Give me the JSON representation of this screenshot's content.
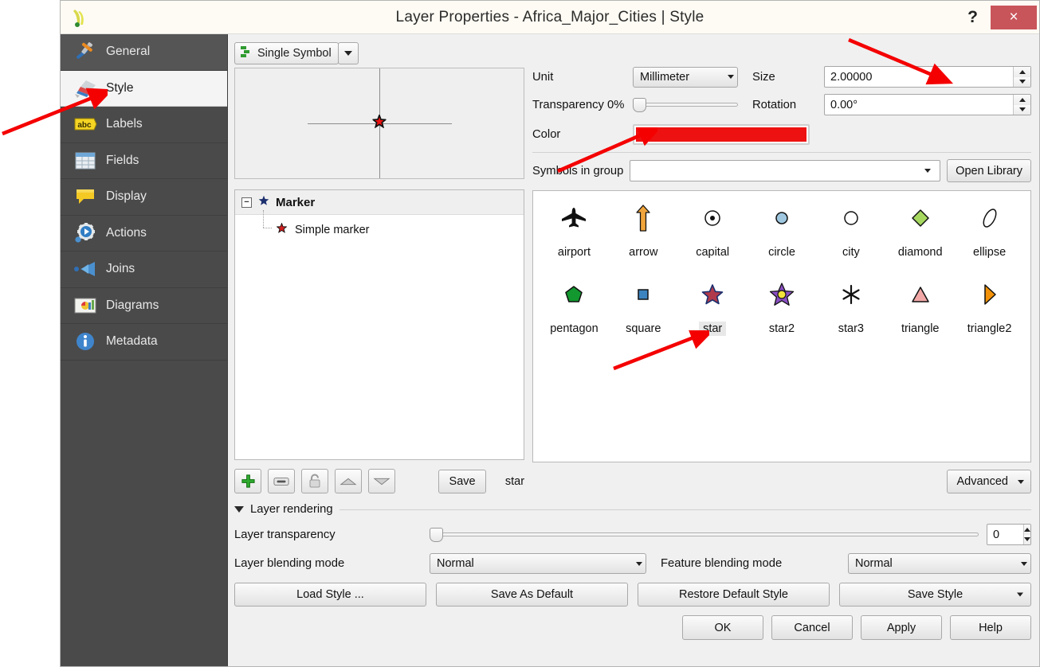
{
  "window": {
    "title": "Layer Properties - Africa_Major_Cities | Style",
    "help_button": "?",
    "close_button": "×",
    "app_icon": "qgis-icon"
  },
  "sidebar": {
    "items": [
      {
        "label": "General",
        "icon": "tools-icon",
        "selected": false
      },
      {
        "label": "Style",
        "icon": "brush-icon",
        "selected": true
      },
      {
        "label": "Labels",
        "icon": "abc-icon",
        "selected": false
      },
      {
        "label": "Fields",
        "icon": "table-icon",
        "selected": false
      },
      {
        "label": "Display",
        "icon": "speech-icon",
        "selected": false
      },
      {
        "label": "Actions",
        "icon": "gear-play-icon",
        "selected": false
      },
      {
        "label": "Joins",
        "icon": "join-icon",
        "selected": false
      },
      {
        "label": "Diagrams",
        "icon": "chart-icon",
        "selected": false
      },
      {
        "label": "Metadata",
        "icon": "info-icon",
        "selected": false
      }
    ]
  },
  "renderer": {
    "mode_label": "Single Symbol",
    "mode_icon": "single-symbol-icon"
  },
  "preview": {
    "symbol": "star-marker",
    "color": "#ee1111"
  },
  "symbol_tree": {
    "root_label": "Marker",
    "child_label": "Simple marker",
    "expander": "−"
  },
  "layer_toolbar": {
    "add_tooltip": "add-symbol-layer",
    "remove_tooltip": "remove-symbol-layer",
    "lock_tooltip": "lock-layer",
    "up_tooltip": "move-up",
    "down_tooltip": "move-down",
    "save_label": "Save",
    "current_symbol_name": "star"
  },
  "properties": {
    "unit_label": "Unit",
    "unit_value": "Millimeter",
    "transparency_label": "Transparency 0%",
    "transparency_value": 0,
    "color_label": "Color",
    "color_value": "#ee1111",
    "size_label": "Size",
    "size_value": "2.00000",
    "rotation_label": "Rotation",
    "rotation_value": "0.00°"
  },
  "group": {
    "label": "Symbols in group",
    "value": "",
    "open_library_label": "Open Library"
  },
  "gallery": {
    "selected": "star",
    "rows": [
      [
        {
          "name": "airport",
          "icon": "airplane-icon",
          "fill": "#000000"
        },
        {
          "name": "arrow",
          "icon": "arrow-up-icon",
          "fill": "#f0a53c"
        },
        {
          "name": "capital",
          "icon": "capital-dot-icon",
          "fill": "#ffffff"
        },
        {
          "name": "circle",
          "icon": "circle-icon",
          "fill": "#9fc8e0"
        },
        {
          "name": "city",
          "icon": "circle-outline-icon",
          "fill": "#ffffff"
        },
        {
          "name": "diamond",
          "icon": "diamond-icon",
          "fill": "#a6d860"
        },
        {
          "name": "ellipse",
          "icon": "ellipse-icon",
          "fill": "#ffffff"
        }
      ],
      [
        {
          "name": "pentagon",
          "icon": "pentagon-icon",
          "fill": "#12982f"
        },
        {
          "name": "square",
          "icon": "square-icon",
          "fill": "#3c84c0"
        },
        {
          "name": "star",
          "icon": "star-icon",
          "fill": "#b03a4a"
        },
        {
          "name": "star2",
          "icon": "star2-icon",
          "fill": "#8a4fc4"
        },
        {
          "name": "star3",
          "icon": "asterisk-icon",
          "fill": "#111111"
        },
        {
          "name": "triangle",
          "icon": "triangle-icon",
          "fill": "#f3a8a8"
        },
        {
          "name": "triangle2",
          "icon": "triangle2-icon",
          "fill": "#f39208"
        }
      ]
    ],
    "advanced_label": "Advanced"
  },
  "layer_rendering": {
    "section_title": "Layer rendering",
    "transparency_label": "Layer transparency",
    "transparency_value": "0",
    "layer_blending_label": "Layer blending mode",
    "layer_blending_value": "Normal",
    "feature_blending_label": "Feature blending mode",
    "feature_blending_value": "Normal"
  },
  "footer": {
    "load_style": "Load Style ...",
    "save_as_default": "Save As Default",
    "restore_default_style": "Restore Default Style",
    "save_style": "Save Style",
    "ok": "OK",
    "cancel": "Cancel",
    "apply": "Apply",
    "help": "Help"
  },
  "annotations": {
    "arrow_color": "#f40000",
    "pointers": [
      "style-tab",
      "size-field",
      "color-swatch",
      "star-symbol"
    ]
  }
}
